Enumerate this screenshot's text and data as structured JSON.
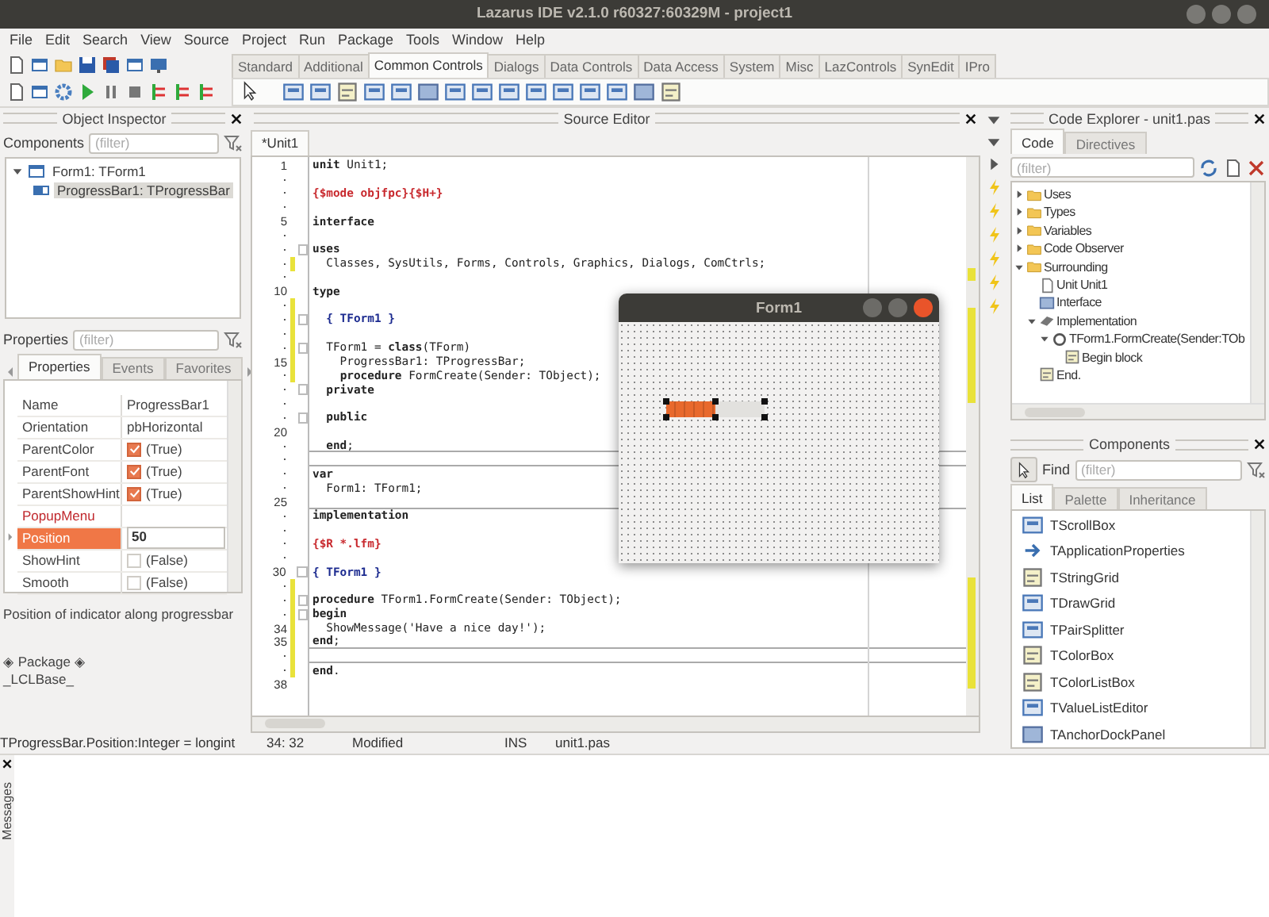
{
  "window": {
    "title": "Lazarus IDE v2.1.0 r60327:60329M - project1"
  },
  "menu": [
    "File",
    "Edit",
    "Search",
    "View",
    "Source",
    "Project",
    "Run",
    "Package",
    "Tools",
    "Window",
    "Help"
  ],
  "palette_tabs": [
    {
      "label": "Standard",
      "selected": false
    },
    {
      "label": "Additional",
      "selected": false
    },
    {
      "label": "Common Controls",
      "selected": true
    },
    {
      "label": "Dialogs",
      "selected": false
    },
    {
      "label": "Data Controls",
      "selected": false
    },
    {
      "label": "Data Access",
      "selected": false
    },
    {
      "label": "System",
      "selected": false
    },
    {
      "label": "Misc",
      "selected": false
    },
    {
      "label": "LazControls",
      "selected": false
    },
    {
      "label": "SynEdit",
      "selected": false
    },
    {
      "label": "IPro",
      "selected": false
    }
  ],
  "object_inspector": {
    "title": "Object Inspector",
    "components_label": "Components",
    "components_filter": {
      "placeholder": "(filter)"
    },
    "tree": [
      {
        "label": "Form1: TForm1",
        "kind": "form",
        "selected": false,
        "expanded": true,
        "children": [
          {
            "label": "ProgressBar1: TProgressBar",
            "kind": "progress",
            "selected": true
          }
        ]
      }
    ],
    "properties_label": "Properties",
    "properties_filter": {
      "placeholder": "(filter)"
    },
    "tabs": [
      {
        "label": "Properties",
        "selected": true
      },
      {
        "label": "Events",
        "selected": false
      },
      {
        "label": "Favorites",
        "selected": false
      }
    ],
    "properties": [
      {
        "name": "Name",
        "value": "ProgressBar1",
        "kind": "text",
        "selected": false
      },
      {
        "name": "Orientation",
        "value": "pbHorizontal",
        "kind": "text",
        "selected": false
      },
      {
        "name": "ParentColor",
        "value": "(True)",
        "kind": "check",
        "checked": true,
        "selected": false
      },
      {
        "name": "ParentFont",
        "value": "(True)",
        "kind": "check",
        "checked": true,
        "selected": false
      },
      {
        "name": "ParentShowHint",
        "value": "(True)",
        "kind": "check",
        "checked": true,
        "selected": false
      },
      {
        "name": "PopupMenu",
        "kind": "reference",
        "selected": false
      },
      {
        "name": "Position",
        "value": "50",
        "kind": "text",
        "selected": true
      },
      {
        "name": "ShowHint",
        "value": "(False)",
        "kind": "check",
        "checked": false,
        "selected": false
      },
      {
        "name": "Smooth",
        "value": "(False)",
        "kind": "check",
        "checked": false,
        "selected": false
      }
    ],
    "hint": "Position of indicator along progressbar",
    "package": "◈ Package ◈",
    "package_name": "_LCLBase_"
  },
  "source_editor": {
    "title": "Source Editor",
    "tabs": [
      {
        "label": "*Unit1",
        "selected": true
      }
    ],
    "lines": [
      {
        "number": "1",
        "code": "**unit** Unit1;",
        "kind": "code",
        "modified": false
      },
      {
        "modified": false
      },
      {
        "code": "{$mode objfpc}{$H+}",
        "kind": "directive",
        "modified": false
      },
      {
        "modified": false
      },
      {
        "number": "5",
        "code": "**interface**",
        "kind": "code",
        "modified": false
      },
      {
        "modified": false
      },
      {
        "code": "**uses**",
        "kind": "code",
        "fold": true,
        "modified": false
      },
      {
        "code": "  Classes, SysUtils, Forms, Controls, Graphics, Dialogs, ComCtrls;",
        "kind": "code",
        "modified": true
      },
      {
        "modified": false
      },
      {
        "number": "10",
        "code": "**type**",
        "kind": "code",
        "modified": false
      },
      {
        "modified": true
      },
      {
        "code": "  { TForm1 }",
        "kind": "comment",
        "fold": true,
        "modified": true
      },
      {
        "modified": true
      },
      {
        "code": "  TForm1 = **class**(TForm)",
        "kind": "code",
        "fold": true,
        "modified": true
      },
      {
        "number": "15",
        "code": "    ProgressBar1: TProgressBar;",
        "kind": "code",
        "modified": true
      },
      {
        "code": "    **procedure** FormCreate(Sender: TObject);",
        "kind": "code",
        "modified": true
      },
      {
        "code": "  **private**",
        "kind": "code",
        "fold": true,
        "modified": false
      },
      {
        "modified": false
      },
      {
        "code": "  **public**",
        "kind": "code",
        "fold": true,
        "modified": false
      },
      {
        "number": "20",
        "modified": false
      },
      {
        "code": "  **end**;",
        "kind": "code",
        "divider_below": true,
        "modified": false
      },
      {
        "divider_below": true,
        "modified": false
      },
      {
        "code": "**var**",
        "kind": "code",
        "modified": false
      },
      {
        "code": "  Form1: TForm1;",
        "kind": "code",
        "modified": false
      },
      {
        "number": "25",
        "divider_below": true,
        "modified": false
      },
      {
        "code": "**implementation**",
        "kind": "code",
        "modified": false
      },
      {
        "modified": false
      },
      {
        "code": "{$R *.lfm}",
        "kind": "directive",
        "modified": false
      },
      {
        "modified": false
      },
      {
        "number": "30",
        "code": "{ TForm1 }",
        "kind": "comment",
        "fold": true,
        "modified": false
      },
      {
        "modified": true
      },
      {
        "code": "**procedure** TForm1.FormCreate(Sender: TObject);",
        "kind": "code",
        "fold": true,
        "modified": true
      },
      {
        "code": "**begin**",
        "kind": "code",
        "fold": true,
        "modified": true
      },
      {
        "number": "34",
        "code": "  ShowMessage('Have a nice day!');",
        "kind": "code",
        "modified": true
      },
      {
        "number": "35",
        "code": "**end**;",
        "kind": "code",
        "modified": true,
        "divider_below": true
      },
      {
        "modified": true,
        "divider_below": true
      },
      {
        "code": "**end**.",
        "kind": "code",
        "modified": true
      },
      {
        "number": "38",
        "modified": false
      }
    ]
  },
  "form_designer": {
    "title": "Form1",
    "progress_bar": {
      "level": 0.5
    }
  },
  "code_explorer": {
    "title": "Code Explorer - unit1.pas",
    "tabs": [
      {
        "label": "Code",
        "selected": true
      },
      {
        "label": "Directives",
        "selected": false
      }
    ],
    "filter": {
      "placeholder": "(filter)"
    },
    "tree": [
      {
        "label": "Uses",
        "kind": "folder",
        "expanded": false
      },
      {
        "label": "Types",
        "kind": "folder",
        "expanded": false
      },
      {
        "label": "Variables",
        "kind": "folder",
        "expanded": false
      },
      {
        "label": "Code Observer",
        "kind": "folder",
        "expanded": false
      },
      {
        "label": "Surrounding",
        "kind": "folder",
        "expanded": true,
        "children": [
          {
            "label": "Unit Unit1",
            "kind": "unit"
          },
          {
            "label": "Interface",
            "kind": "interface"
          },
          {
            "label": "Implementation",
            "kind": "implementation",
            "expanded": true,
            "children": [
              {
                "label": "TForm1.FormCreate(Sender:TOb",
                "kind": "procedure",
                "expanded": true,
                "children": [
                  {
                    "label": "Begin block",
                    "kind": "block"
                  }
                ]
              }
            ]
          },
          {
            "label": "End.",
            "kind": "block"
          }
        ]
      }
    ]
  },
  "components": {
    "title": "Components",
    "find_label": "Find",
    "filter": {
      "placeholder": "(filter)"
    },
    "tabs": [
      {
        "label": "List",
        "selected": true
      },
      {
        "label": "Palette",
        "selected": false
      },
      {
        "label": "Inheritance",
        "selected": false
      }
    ],
    "items": [
      "TScrollBox",
      "TApplicationProperties",
      "TStringGrid",
      "TDrawGrid",
      "TPairSplitter",
      "TColorBox",
      "TColorListBox",
      "TValueListEditor",
      "TAnchorDockPanel"
    ]
  },
  "status_bar": [
    "TProgressBar.Position:Integer = longint",
    "34: 32",
    "Modified",
    "INS",
    "unit1.pas"
  ],
  "messages": {
    "title": "Messages"
  }
}
